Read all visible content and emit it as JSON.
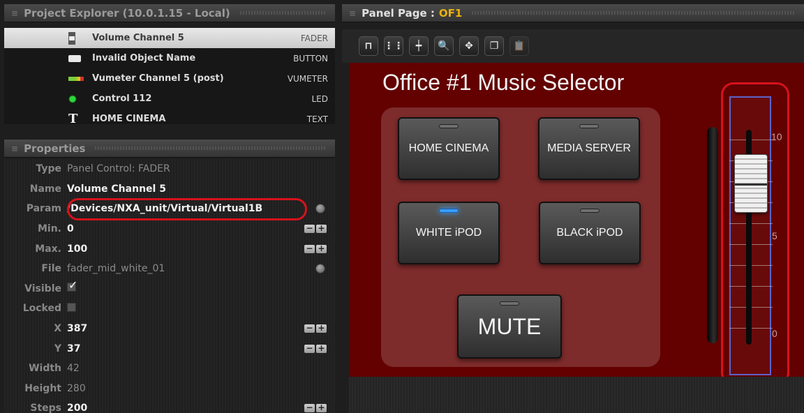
{
  "explorer": {
    "title": "Project Explorer (10.0.1.15 - Local)",
    "items": [
      {
        "name": "Volume Channel 5",
        "type": "FADER",
        "icon": "fader-icon",
        "selected": true
      },
      {
        "name": "Invalid Object Name",
        "type": "BUTTON",
        "icon": "button-icon",
        "selected": false
      },
      {
        "name": "Vumeter Channel 5 (post)",
        "type": "VUMETER",
        "icon": "vumeter-icon",
        "selected": false
      },
      {
        "name": "Control 112",
        "type": "LED",
        "icon": "led-icon",
        "selected": false
      },
      {
        "name": "HOME CINEMA",
        "type": "TEXT",
        "icon": "text-icon",
        "selected": false
      }
    ]
  },
  "properties": {
    "title": "Properties",
    "type_label": "Type",
    "type_value": "Panel Control: FADER",
    "name_label": "Name",
    "name_value": "Volume Channel 5",
    "param_label": "Param",
    "param_value": "/Devices/NXA_unit/Virtual/Virtual1B",
    "min_label": "Min.",
    "min_value": "0",
    "max_label": "Max.",
    "max_value": "100",
    "file_label": "File",
    "file_value": "fader_mid_white_01",
    "visible_label": "Visible",
    "visible_checked": true,
    "locked_label": "Locked",
    "locked_checked": false,
    "x_label": "X",
    "x_value": "387",
    "y_label": "Y",
    "y_value": "37",
    "width_label": "Width",
    "width_value": "42",
    "height_label": "Height",
    "height_value": "280",
    "steps_label": "Steps",
    "steps_value": "200",
    "stepper_minus": "−",
    "stepper_plus": "+"
  },
  "panel_page": {
    "title_prefix": "Panel Page :",
    "title_name": "OF1",
    "accent_color": "#e7b010"
  },
  "toolbar": {
    "buttons": [
      {
        "icon": "ruler-icon",
        "glyph": "⊓"
      },
      {
        "icon": "grid-icon",
        "glyph": "⋮⋮"
      },
      {
        "icon": "snap-icon",
        "glyph": "┿"
      },
      {
        "icon": "zoom-x2-icon",
        "glyph": "🔍"
      },
      {
        "icon": "move-icon",
        "glyph": "✥"
      },
      {
        "icon": "copy-icon",
        "glyph": "❐"
      },
      {
        "icon": "paste-icon",
        "glyph": "📋"
      }
    ]
  },
  "panel": {
    "heading": "Office #1 Music Selector",
    "background_color": "#630000",
    "buttons": {
      "home_cinema": "HOME CINEMA",
      "media_server": "MEDIA SERVER",
      "white_ipod": "WHITE iPOD",
      "black_ipod": "BLACK iPOD",
      "mute": "MUTE"
    },
    "active_button": "white_ipod",
    "fader": {
      "scale_top": "10",
      "scale_mid": "5",
      "scale_bottom": "0",
      "level_fraction": 0.75
    }
  }
}
